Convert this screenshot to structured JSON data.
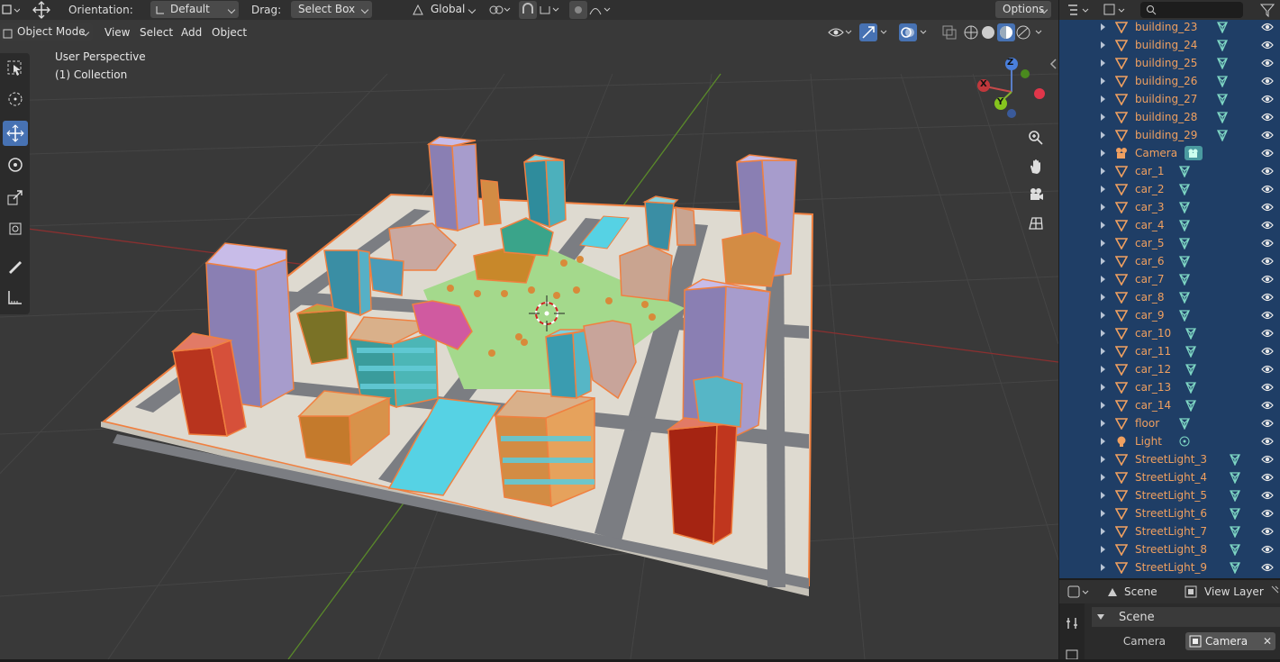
{
  "header": {
    "orientation_label": "Orientation:",
    "orientation_value": "Default",
    "drag_label": "Drag:",
    "drag_value": "Select Box",
    "transform_value": "Global",
    "options_label": "Options"
  },
  "viewport_header": {
    "mode": "Object Mode",
    "menus": [
      "View",
      "Select",
      "Add",
      "Object"
    ]
  },
  "viewport": {
    "perspective": "User Perspective",
    "collection": "(1) Collection",
    "gizmo": {
      "x": "X",
      "y": "Y",
      "z": "Z"
    }
  },
  "toolbar": {
    "tools": [
      "select-box",
      "cursor",
      "move",
      "rotate",
      "scale",
      "transform",
      "annotate",
      "measure"
    ],
    "active": "move"
  },
  "navigation": [
    "zoom-icon",
    "hand-icon",
    "camera-icon",
    "grid-icon"
  ],
  "outliner": {
    "items": [
      {
        "name": "building_23",
        "type": "mesh"
      },
      {
        "name": "building_24",
        "type": "mesh"
      },
      {
        "name": "building_25",
        "type": "mesh"
      },
      {
        "name": "building_26",
        "type": "mesh"
      },
      {
        "name": "building_27",
        "type": "mesh"
      },
      {
        "name": "building_28",
        "type": "mesh"
      },
      {
        "name": "building_29",
        "type": "mesh"
      },
      {
        "name": "Camera",
        "type": "camera"
      },
      {
        "name": "car_1",
        "type": "mesh"
      },
      {
        "name": "car_2",
        "type": "mesh"
      },
      {
        "name": "car_3",
        "type": "mesh"
      },
      {
        "name": "car_4",
        "type": "mesh"
      },
      {
        "name": "car_5",
        "type": "mesh"
      },
      {
        "name": "car_6",
        "type": "mesh"
      },
      {
        "name": "car_7",
        "type": "mesh"
      },
      {
        "name": "car_8",
        "type": "mesh"
      },
      {
        "name": "car_9",
        "type": "mesh"
      },
      {
        "name": "car_10",
        "type": "mesh"
      },
      {
        "name": "car_11",
        "type": "mesh"
      },
      {
        "name": "car_12",
        "type": "mesh"
      },
      {
        "name": "car_13",
        "type": "mesh"
      },
      {
        "name": "car_14",
        "type": "mesh"
      },
      {
        "name": "floor",
        "type": "mesh"
      },
      {
        "name": "Light",
        "type": "light"
      },
      {
        "name": "StreetLight_3",
        "type": "mesh"
      },
      {
        "name": "StreetLight_4",
        "type": "mesh"
      },
      {
        "name": "StreetLight_5",
        "type": "mesh"
      },
      {
        "name": "StreetLight_6",
        "type": "mesh"
      },
      {
        "name": "StreetLight_7",
        "type": "mesh"
      },
      {
        "name": "StreetLight_8",
        "type": "mesh"
      },
      {
        "name": "StreetLight_9",
        "type": "mesh"
      }
    ]
  },
  "properties": {
    "tab_scene": "Scene",
    "tab_view_layer": "View Layer",
    "panel_title": "Scene",
    "camera_label": "Camera",
    "camera_value": "Camera"
  },
  "colors": {
    "selection": "#f08040",
    "active_tool": "#4772b3",
    "outliner_bg": "#1f3e66",
    "mesh_icon": "#7ed6c4"
  }
}
